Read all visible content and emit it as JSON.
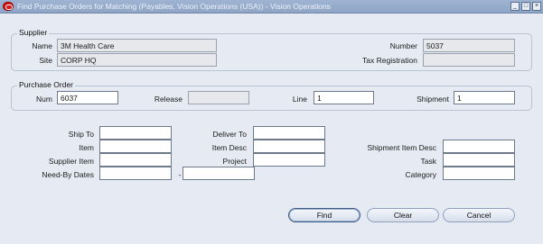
{
  "window": {
    "title": "Find Purchase Orders for Matching (Payables, Vision Operations (USA)) - Vision Operations",
    "controls": {
      "minimize": "_",
      "maximize": "□",
      "close": "×"
    }
  },
  "supplier": {
    "group_label": "Supplier",
    "name_label": "Name",
    "name_value": "3M Health Care",
    "site_label": "Site",
    "site_value": "CORP HQ",
    "number_label": "Number",
    "number_value": "5037",
    "tax_label": "Tax Registration",
    "tax_value": ""
  },
  "purchase_order": {
    "group_label": "Purchase Order",
    "num_label": "Num",
    "num_value": "6037",
    "release_label": "Release",
    "release_value": "",
    "line_label": "Line",
    "line_value": "1",
    "shipment_label": "Shipment",
    "shipment_value": "1"
  },
  "criteria": {
    "ship_to_label": "Ship To",
    "deliver_to_label": "Deliver To",
    "item_label": "Item",
    "item_desc_label": "Item Desc",
    "shipment_item_desc_label": "Shipment Item Desc",
    "supplier_item_label": "Supplier Item",
    "project_label": "Project",
    "task_label": "Task",
    "need_by_label": "Need-By Dates",
    "date_sep": "-",
    "category_label": "Category",
    "ship_to_value": "",
    "deliver_to_value": "",
    "item_value": "",
    "item_desc_value": "",
    "shipment_item_desc_value": "",
    "supplier_item_value": "",
    "project_value": "",
    "task_value": "",
    "need_by_from_value": "",
    "need_by_to_value": "",
    "category_value": ""
  },
  "buttons": {
    "find": "Find",
    "clear": "Clear",
    "cancel": "Cancel"
  }
}
